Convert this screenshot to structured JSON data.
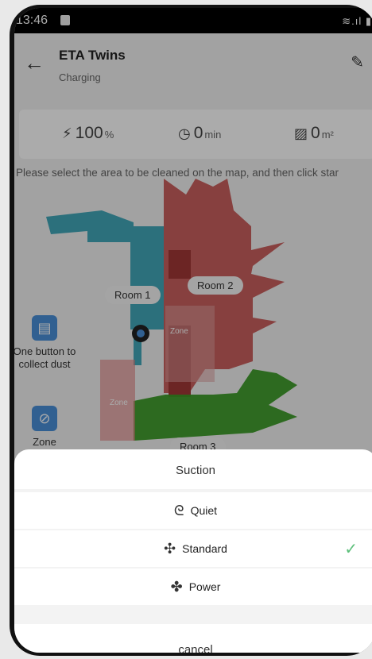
{
  "status": {
    "time": "13:46"
  },
  "header": {
    "title": "ETA Twins",
    "subtitle": "Charging"
  },
  "stats": {
    "battery": {
      "value": "100",
      "unit": "%"
    },
    "time": {
      "value": "0",
      "unit": "min"
    },
    "area": {
      "value": "0",
      "unit": "m²"
    }
  },
  "hint": "Please select the area to be cleaned on the map, and then click star",
  "map": {
    "rooms": [
      "Room 1",
      "Room 2",
      "Room 3"
    ],
    "zone_label": "Zone",
    "side_buttons": [
      "One button to collect dust",
      "Zone"
    ]
  },
  "sheet": {
    "title": "Suction",
    "options": [
      {
        "label": "Quiet",
        "icon": "fan-low-icon",
        "selected": false
      },
      {
        "label": "Standard",
        "icon": "fan-medium-icon",
        "selected": true
      },
      {
        "label": "Power",
        "icon": "fan-high-icon",
        "selected": false
      }
    ],
    "cancel": "cancel"
  },
  "colors": {
    "room1": "#2f9fb3",
    "room2": "#c5504e",
    "room3": "#3a9a25",
    "check": "#5cbf7a"
  }
}
